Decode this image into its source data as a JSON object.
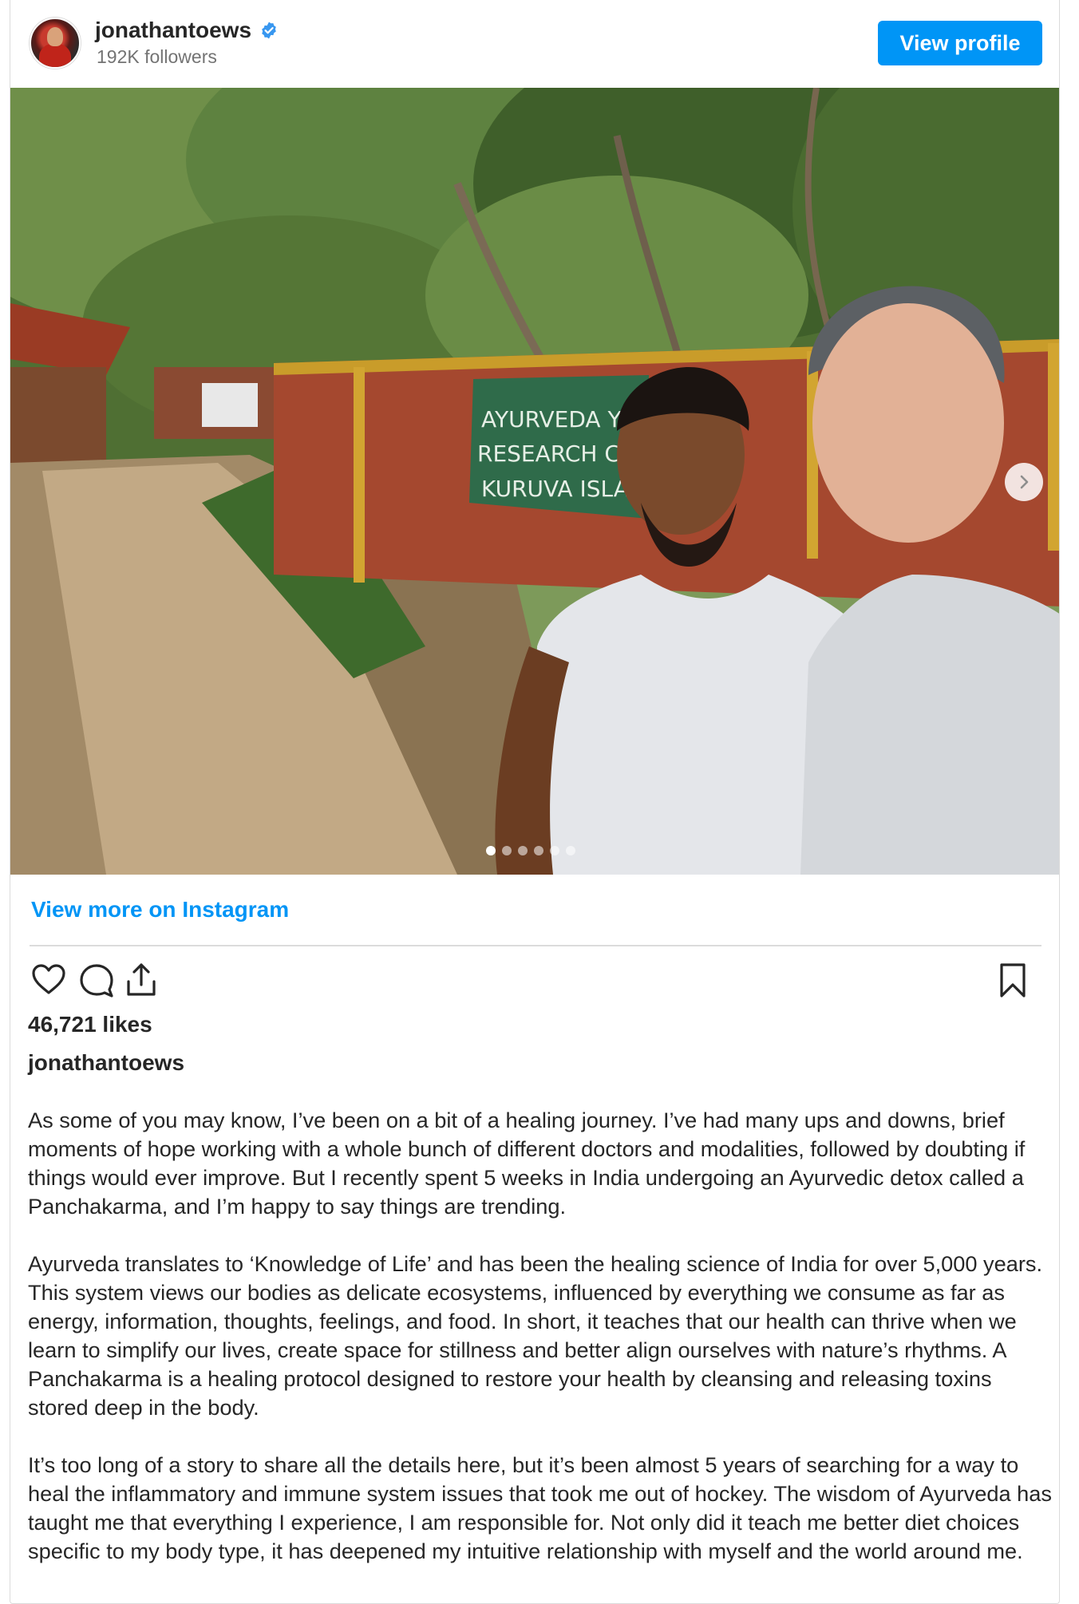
{
  "header": {
    "username": "jonathantoews",
    "followers": "192K followers",
    "view_profile_label": "View profile"
  },
  "photo": {
    "sign_text": [
      "AYURVEDA YOGA",
      "RESEARCH CENT",
      "KURUVA ISLAND"
    ],
    "carousel_total": 6,
    "carousel_active": 1
  },
  "view_more_label": "View more on Instagram",
  "likes": "46,721 likes",
  "caption": {
    "username": "jonathantoews",
    "paragraphs": [
      "As some of you may know, I’ve been on a bit of a healing journey. I’ve had many ups and downs, brief moments of hope working with a whole bunch of different doctors and modalities, followed by doubting if things would ever improve. But I recently spent 5 weeks in India undergoing an Ayurvedic detox called a Panchakarma, and I’m happy to say things are trending.",
      "Ayurveda translates to ‘Knowledge of Life’ and has been the healing science of India for over 5,000 years. This system views our bodies as delicate ecosystems, influenced by everything we consume as far as energy, information, thoughts, feelings, and food. In short, it teaches that our health can thrive when we learn to simplify our lives, create space for stillness and better align ourselves with nature’s rhythms. A Panchakarma is a healing protocol designed to restore your health by cleansing and releasing toxins stored deep in the body.",
      "It’s too long of a story to share all the details here, but it’s been almost 5 years of searching for a way to heal the inflammatory and immune system issues that took me out of hockey. The wisdom of Ayurveda has taught me that everything I experience, I am responsible for. Not only did it teach me better diet choices specific to my body type, it has deepened my intuitive relationship with myself and the world around me."
    ]
  },
  "icons": {
    "like": "heart-icon",
    "comment": "comment-icon",
    "share": "share-icon",
    "save": "bookmark-icon",
    "verified": "verified-badge-icon",
    "next": "chevron-right-icon"
  },
  "colors": {
    "accent": "#0095f6",
    "text": "#262626",
    "muted": "#737373"
  }
}
